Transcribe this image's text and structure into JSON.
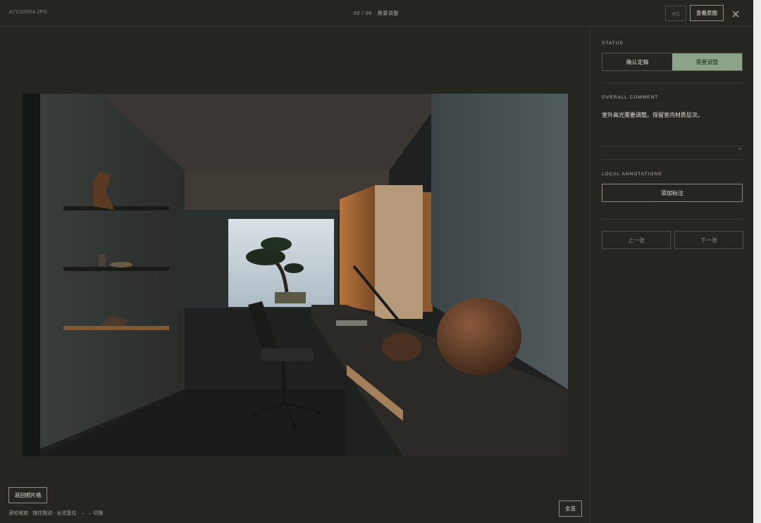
{
  "header": {
    "filename": "A7C02064.JPG",
    "counter": "02 / 06 · 需要调整",
    "compare_label": "对比",
    "view_original_label": "查看原图",
    "close_icon": "close-icon"
  },
  "viewer": {
    "back_label": "返回照片墙",
    "hints": "滚轮缩放 · 按住拖动 · 全览复位 · ← → 切换",
    "full_label": "全览",
    "photo_subject": "dark study interior with bonsai window"
  },
  "panel": {
    "status_label": "STATUS",
    "status_options": [
      "确认定稿",
      "需要调整"
    ],
    "status_selected": "需要调整",
    "comment_label": "OVERALL COMMENT",
    "comment_text": "室外高光需要调整。保留室内材质层次。",
    "annotations_label": "LOCAL ANNOTATIONS",
    "add_annotation_label": "添加标注",
    "prev_label": "上一张",
    "next_label": "下一张"
  },
  "colors": {
    "background": "#262620",
    "accent_selected": "#8da48a",
    "text": "#d9d6cc"
  }
}
